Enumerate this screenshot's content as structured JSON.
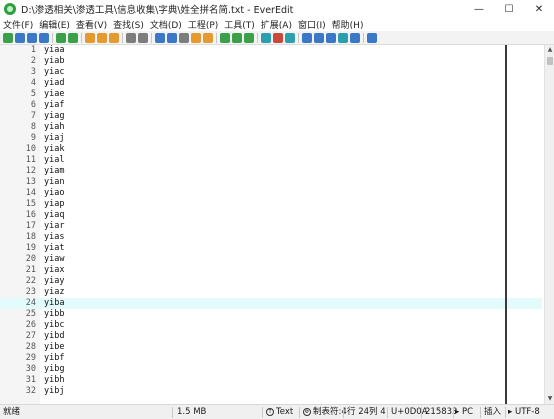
{
  "window": {
    "title": "D:\\渗透相关\\渗透工具\\信息收集\\字典\\姓全拼名简.txt - EverEdit",
    "minimize_glyph": "—",
    "maximize_glyph": "☐",
    "close_glyph": "✕"
  },
  "menu": [
    "文件(F)",
    "编辑(E)",
    "查看(V)",
    "查找(S)",
    "文档(D)",
    "工程(P)",
    "工具(T)",
    "扩展(A)",
    "窗口(I)",
    "帮助(H)"
  ],
  "toolbar": {
    "icons": [
      "new-file-icon",
      "open-file-icon",
      "save-icon",
      "save-all-icon",
      "separator",
      "undo-icon",
      "redo-icon",
      "separator",
      "cut-icon",
      "copy-icon",
      "paste-icon",
      "separator",
      "indent-icon",
      "column-mode-icon",
      "separator",
      "find-icon",
      "find-in-files-icon",
      "replace-icon",
      "mark-icon",
      "bookmark-icon",
      "separator",
      "macro-icon",
      "record-icon",
      "play-icon",
      "separator",
      "browser-icon",
      "color-icon",
      "pin-icon",
      "separator",
      "panel-icon",
      "split-icon",
      "list-icon",
      "terminal-icon",
      "web-icon",
      "separator",
      "help-icon"
    ],
    "colors": {
      "blue": "#3c78c8",
      "green": "#3aa04a",
      "orange": "#e49a2e",
      "gray": "#7d7d7d",
      "teal": "#2b9fb0",
      "red": "#c94a3a"
    }
  },
  "editor": {
    "current_line": 24,
    "lines": [
      {
        "num": "1",
        "text": "yiaa"
      },
      {
        "num": "2",
        "text": "yiab"
      },
      {
        "num": "3",
        "text": "yiac"
      },
      {
        "num": "4",
        "text": "yiad"
      },
      {
        "num": "5",
        "text": "yiae"
      },
      {
        "num": "6",
        "text": "yiaf"
      },
      {
        "num": "7",
        "text": "yiag"
      },
      {
        "num": "8",
        "text": "yiah"
      },
      {
        "num": "9",
        "text": "yiaj"
      },
      {
        "num": "10",
        "text": "yiak"
      },
      {
        "num": "11",
        "text": "yial"
      },
      {
        "num": "12",
        "text": "yiam"
      },
      {
        "num": "13",
        "text": "yian"
      },
      {
        "num": "14",
        "text": "yiao"
      },
      {
        "num": "15",
        "text": "yiap"
      },
      {
        "num": "16",
        "text": "yiaq"
      },
      {
        "num": "17",
        "text": "yiar"
      },
      {
        "num": "18",
        "text": "yias"
      },
      {
        "num": "19",
        "text": "yiat"
      },
      {
        "num": "20",
        "text": "yiaw"
      },
      {
        "num": "21",
        "text": "yiax"
      },
      {
        "num": "22",
        "text": "yiay"
      },
      {
        "num": "23",
        "text": "yiaz"
      },
      {
        "num": "24",
        "text": "yiba"
      },
      {
        "num": "25",
        "text": "yibb"
      },
      {
        "num": "26",
        "text": "yibc"
      },
      {
        "num": "27",
        "text": "yibd"
      },
      {
        "num": "28",
        "text": "yibe"
      },
      {
        "num": "29",
        "text": "yibf"
      },
      {
        "num": "30",
        "text": "yibg"
      },
      {
        "num": "31",
        "text": "yibh"
      },
      {
        "num": "32",
        "text": "yibj"
      }
    ]
  },
  "status": {
    "ready": "就绪",
    "size": "1.5 MB",
    "mode": "Text",
    "tab": "制表符:4",
    "line": "行 24",
    "col": "列 4",
    "char": "U+0D0A",
    "count": "215833",
    "eol": "PC",
    "insert": "插入",
    "encoding": "UTF-8"
  }
}
